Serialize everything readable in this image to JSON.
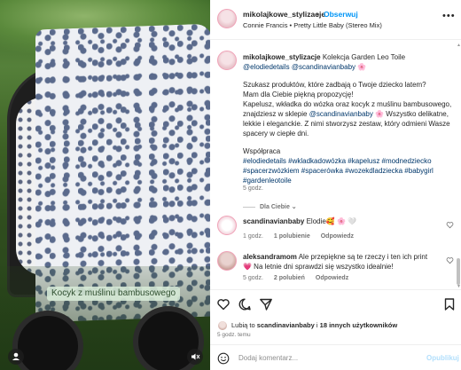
{
  "media": {
    "caption_chip": "Kocyk z muślinu bambusowego",
    "user_icon": "user-icon",
    "sound_icon": "muted-speaker-icon"
  },
  "header": {
    "username": "mikolajkowe_stylizacje",
    "dot": "•",
    "follow": "Obserwuj",
    "audio": "Connie Francis • Pretty Little Baby (Stereo Mix)",
    "more_icon": "more-options-icon",
    "more_glyph": "•••"
  },
  "caption": {
    "username": "mikolajkowe_stylizacje",
    "line1_text": " Kolekcja Garden Leo Toile ",
    "line1_tag1": "@elodiedetails",
    "line1_tag2": "@scandinavianbaby",
    "line1_emoji": " 🌸",
    "para1": "Szukasz produktów, które zadbają o Twoje dziecko latem?",
    "para2": "Mam dla Ciebie piękną propozycję!",
    "para3_a": "Kapelusz, wkładka do wózka oraz kocyk z muślinu bambusowego, znajdziesz w sklepie ",
    "para3_tag": "@scandinavianbaby",
    "para3_b": " 🌸 Wszystko delikatne, lekkie i eleganckie. Z nimi stworzysz zestaw, który odmieni Wasze spacery w ciepłe dni.",
    "coop": "Współpraca",
    "hashtags": "#elodiedetails #wkladkadowózka #kapelusz #modnedziecko #spacerzwózkiem #spacerówka #wozekdladziecka #babygirl #gardenleotoile",
    "time": "5 godz."
  },
  "view_replies": "Dla Ciebie ⌄",
  "comments": [
    {
      "username": "scandinavianbaby",
      "text": " Elodie🥰 🌸 🤍",
      "time": "1 godz.",
      "likes": "1 polubienie",
      "reply": "Odpowiedz"
    },
    {
      "username": "aleksandramom",
      "text": " Ale przepiękne są te rzeczy i ten ich print 💗 Na letnie dni sprawdzi się wszystko idealnie!",
      "time": "5 godz.",
      "likes": "2 polubień",
      "reply": "Odpowiedz"
    }
  ],
  "likes": {
    "prefix": "Lubią to ",
    "user": "scandinavianbaby",
    "mid": " i ",
    "others": "18 innych użytkowników"
  },
  "posted": "5 godz. temu",
  "composer": {
    "placeholder": "Dodaj komentarz...",
    "publish": "Opublikuj"
  }
}
